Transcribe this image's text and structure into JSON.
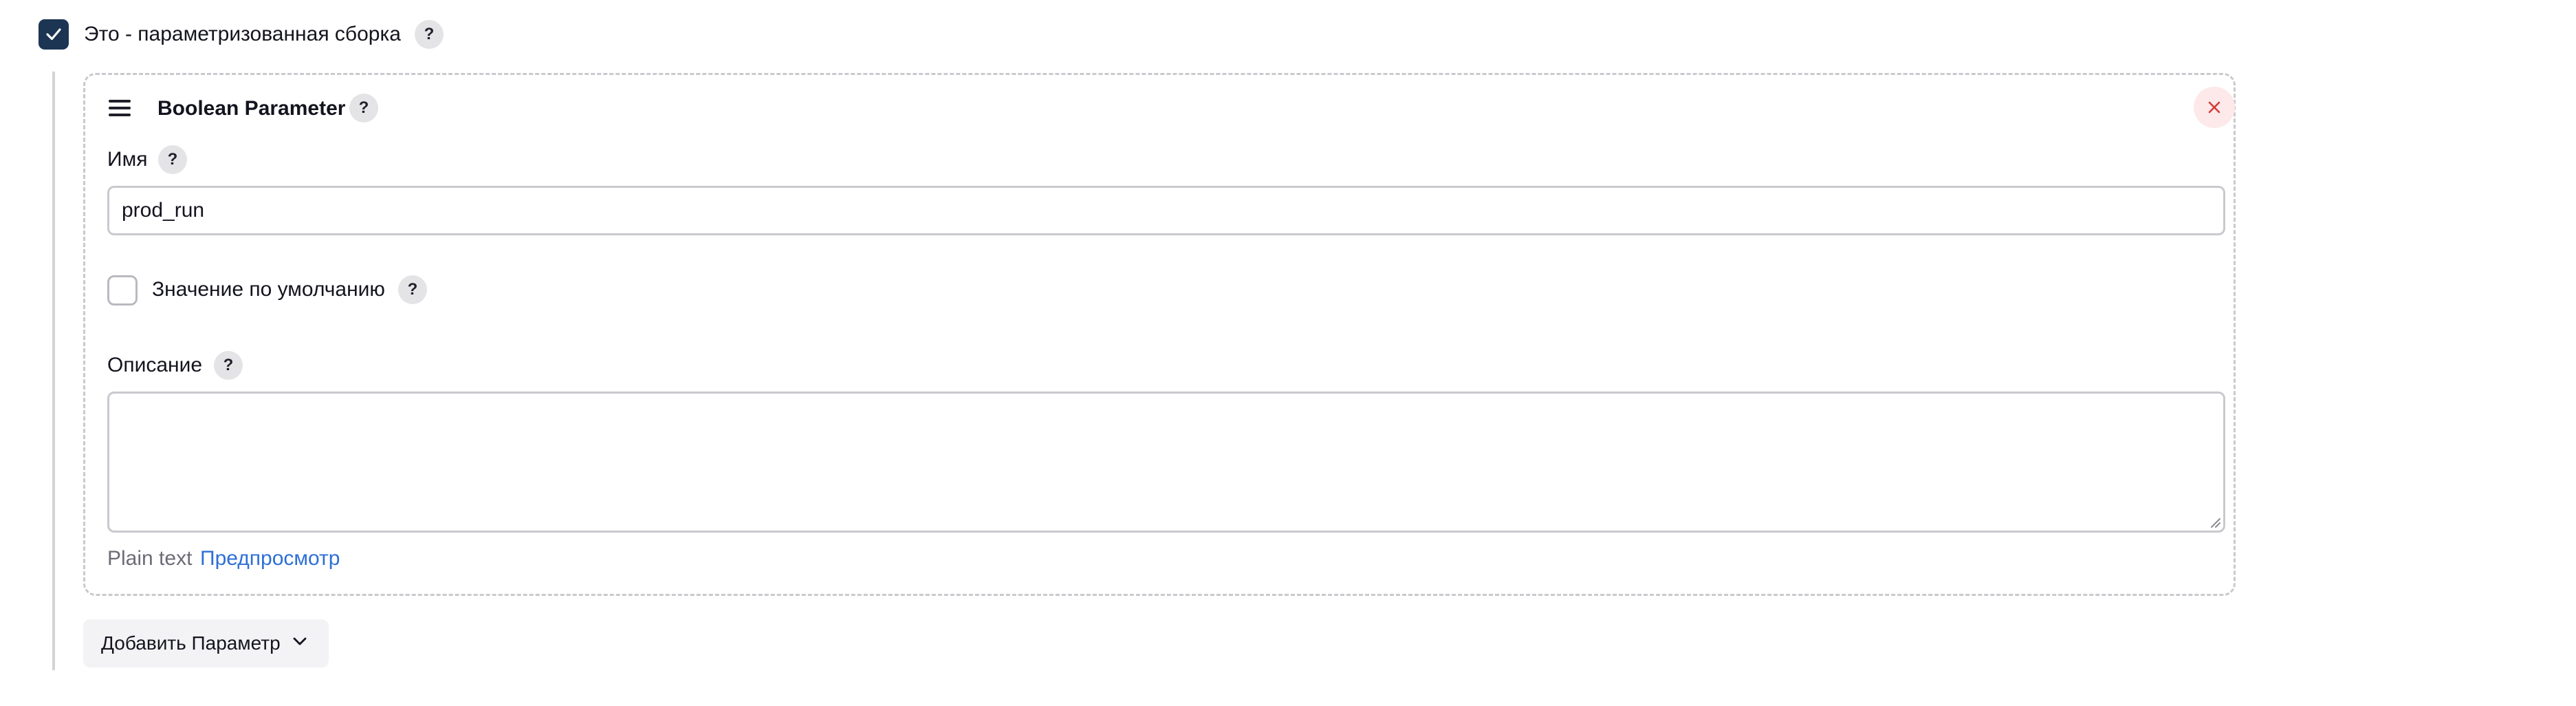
{
  "parameterized_build": {
    "label": "Это - параметризованная сборка",
    "checked": true,
    "help": "?"
  },
  "parameter_card": {
    "title": "Boolean Parameter",
    "help": "?",
    "name_field": {
      "label": "Имя",
      "help": "?",
      "value": "prod_run"
    },
    "default_value": {
      "label": "Значение по умолчанию",
      "help": "?",
      "checked": false
    },
    "description": {
      "label": "Описание",
      "help": "?",
      "value": ""
    },
    "format": {
      "plain_text": "Plain text",
      "preview_link": "Предпросмотр"
    }
  },
  "add_parameter_button": {
    "label": "Добавить Параметр"
  },
  "icons": {
    "top_checkbox": "checkmark-icon",
    "drag": "drag-handle-icon",
    "close": "close-icon",
    "dropdown": "chevron-down-icon"
  },
  "colors": {
    "checkbox_checked": "#1c3553",
    "link": "#2d6fd6",
    "close_bg": "#fde9e9",
    "close_icon": "#d33a3a",
    "help_bg": "#e4e4e7"
  }
}
